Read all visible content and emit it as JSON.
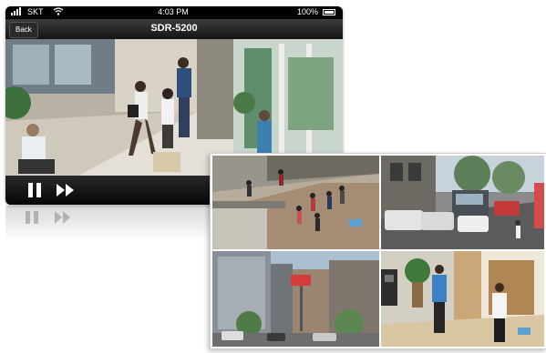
{
  "status_bar": {
    "carrier": "SKT",
    "time": "4:03 PM",
    "battery": "100%"
  },
  "nav": {
    "back_label": "Back",
    "title": "SDR-5200"
  },
  "player": {
    "pause_icon": "pause-icon",
    "fast_forward_icon": "fast-forward-icon"
  },
  "quad_view": {
    "cameras": [
      "camera-1",
      "camera-2",
      "camera-3",
      "camera-4"
    ]
  }
}
